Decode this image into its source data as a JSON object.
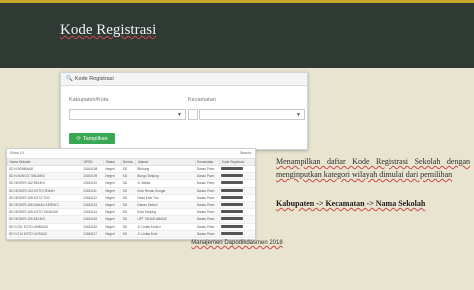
{
  "slide": {
    "title": "Kode Registrasi",
    "description": "Menampilkan daftar Kode Registrasi Sekolah dengan menginputkan kategori wilayah dimulai dari pemilihan",
    "path": "Kabupaten -> Kecamatan -> Nama Sekolah",
    "footer": "Manajemen Dapodikdasmen 2018"
  },
  "panel": {
    "heading": "Kode Registrasi",
    "kabupaten_label": "Kabupaten/Kota",
    "kecamatan_label": "Kecamatan",
    "button_label": "Tampilkan"
  },
  "table": {
    "show_label": "Show",
    "entries_value": "10",
    "search_label": "Search:",
    "headers": [
      "Nama Sekolah",
      "NPSN",
      "Status",
      "Bentuk",
      "Alamat",
      "Kecamatan",
      "Kode Registrasi"
    ],
    "rows": [
      [
        "SD N BEMBAND",
        "10184108",
        "Negeri",
        "SD",
        "Bibirung",
        "Danau Pann"
      ],
      [
        "SD N BUNGO TANJUNG",
        "10184109",
        "Negeri",
        "SD",
        "Bungo Tanjung",
        "Danau Pann"
      ],
      [
        "SD NEGERI 162 BELIKO",
        "10184110",
        "Negeri",
        "SD",
        "Jl. Belika",
        "Danau Pann"
      ],
      [
        "SD NEGERI 163 KOTO RENAH",
        "10184111",
        "Negeri",
        "SD",
        "Koto Renah Sungai",
        "Danau Pann"
      ],
      [
        "SD NEGERI 165 KOTO TUO",
        "10184112",
        "Negeri",
        "SD",
        "Desa Koto Tuo",
        "Danau Pann"
      ],
      [
        "SD NEGERI 166 DANAU KERINCI",
        "10184113",
        "Negeri",
        "SD",
        "Danau Kerinci",
        "Danau Pann"
      ],
      [
        "SD NEGERI 169 KOTO TANJUNG",
        "10184114",
        "Negeri",
        "SD",
        "Koto Tanjung",
        "Danau Pann"
      ],
      [
        "SD NEGERI 165 BELIKO",
        "10184115",
        "Negeri",
        "SD",
        "UPT TANAH ABANG",
        "Danau Pann"
      ],
      [
        "SD N 201 KOTO LIMBUNG",
        "10184116",
        "Negeri",
        "SD",
        "Jl. Lintas Kerinci",
        "Danau Pann"
      ],
      [
        "SD N 214 KOTO LINTANG",
        "10184117",
        "Negeri",
        "SD",
        "Jl. Lintas Koto",
        "Danau Pann"
      ]
    ]
  },
  "colors": {
    "band": "#2f3a35",
    "accent_line": "#c8a92c",
    "background": "#e8e4d0",
    "button": "#3aa853"
  }
}
